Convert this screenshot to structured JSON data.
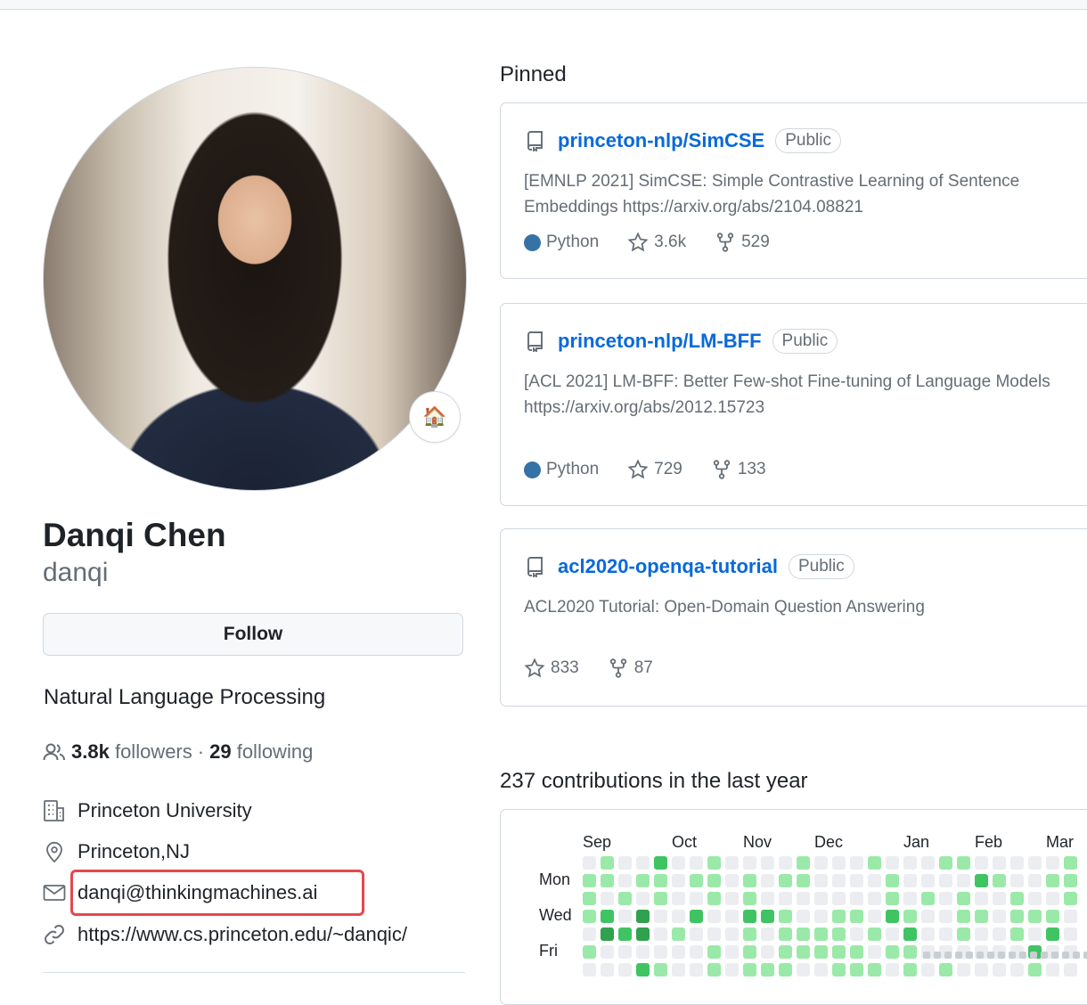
{
  "profile": {
    "name": "Danqi Chen",
    "login": "danqi",
    "status_emoji": "🏠",
    "follow_label": "Follow",
    "bio": "Natural Language Processing",
    "followers_count": "3.8k",
    "followers_label": "followers",
    "separator": "·",
    "following_count": "29",
    "following_label": "following",
    "organization": "Princeton University",
    "location": "Princeton,NJ",
    "email": "danqi@thinkingmachines.ai",
    "website": "https://www.cs.princeton.edu/~danqic/",
    "highlight_color": "#e5484d"
  },
  "pinned": {
    "title": "Pinned",
    "repos": [
      {
        "name": "princeton-nlp/SimCSE",
        "visibility": "Public",
        "description": "[EMNLP 2021] SimCSE: Simple Contrastive Learning of Sentence Embeddings https://arxiv.org/abs/2104.08821",
        "language": "Python",
        "language_color": "#3572A5",
        "stars": "3.6k",
        "forks": "529"
      },
      {
        "name": "princeton-nlp/LM-BFF",
        "visibility": "Public",
        "description": "[ACL 2021] LM-BFF: Better Few-shot Fine-tuning of Language Models https://arxiv.org/abs/2012.15723",
        "language": "Python",
        "language_color": "#3572A5",
        "stars": "729",
        "forks": "133"
      },
      {
        "name": "acl2020-openqa-tutorial",
        "visibility": "Public",
        "description": "ACL2020 Tutorial: Open-Domain Question Answering",
        "stars": "833",
        "forks": "87"
      }
    ]
  },
  "contributions": {
    "title": "237 contributions in the last year",
    "months": [
      "Sep",
      "Oct",
      "Nov",
      "Dec",
      "Jan",
      "Feb",
      "Mar"
    ],
    "days": [
      "Mon",
      "Wed",
      "Fri"
    ],
    "levels": [
      [
        0,
        1,
        0,
        0,
        2,
        0,
        0,
        1,
        0,
        0,
        0,
        0,
        1,
        0,
        0,
        0,
        1,
        0,
        0,
        0,
        1,
        1,
        0,
        0,
        0,
        0,
        0,
        1
      ],
      [
        1,
        1,
        0,
        1,
        1,
        0,
        1,
        1,
        0,
        1,
        0,
        1,
        1,
        0,
        0,
        0,
        0,
        1,
        0,
        0,
        0,
        0,
        2,
        1,
        0,
        0,
        1,
        1
      ],
      [
        1,
        0,
        1,
        0,
        1,
        0,
        0,
        1,
        0,
        1,
        0,
        0,
        0,
        0,
        0,
        0,
        0,
        1,
        0,
        1,
        0,
        1,
        0,
        0,
        1,
        0,
        0,
        1
      ],
      [
        1,
        2,
        0,
        3,
        0,
        0,
        2,
        0,
        0,
        2,
        2,
        1,
        0,
        0,
        1,
        1,
        0,
        2,
        1,
        0,
        0,
        1,
        1,
        0,
        1,
        1,
        1,
        0
      ],
      [
        0,
        3,
        2,
        3,
        0,
        1,
        0,
        0,
        0,
        1,
        0,
        1,
        1,
        1,
        1,
        0,
        1,
        0,
        2,
        0,
        0,
        1,
        0,
        0,
        1,
        0,
        2,
        0
      ],
      [
        1,
        0,
        0,
        0,
        0,
        0,
        0,
        1,
        0,
        1,
        0,
        1,
        1,
        1,
        1,
        1,
        0,
        1,
        1,
        0,
        0,
        0,
        0,
        0,
        0,
        2,
        0,
        0
      ],
      [
        0,
        0,
        0,
        2,
        1,
        0,
        0,
        1,
        0,
        1,
        1,
        1,
        0,
        0,
        1,
        1,
        1,
        0,
        1,
        0,
        1,
        0,
        0,
        0,
        0,
        1,
        0,
        0
      ]
    ],
    "level_colors": [
      "#ebedf0",
      "#9be9a8",
      "#40c463",
      "#30a14e",
      "#216e39"
    ]
  }
}
